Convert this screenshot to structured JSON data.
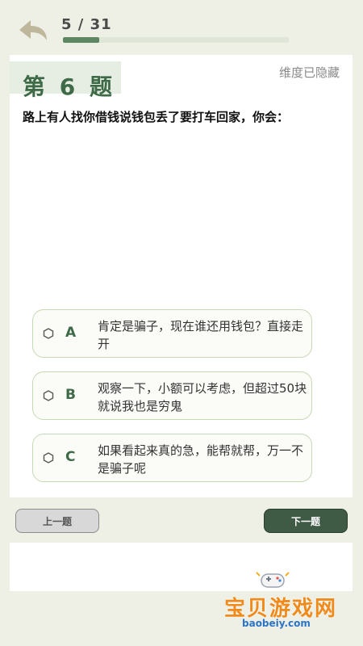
{
  "header": {
    "progress_text": "5 / 31",
    "progress_fraction": 0.161
  },
  "question": {
    "number_label": "第 6 题",
    "dimension_label": "维度已隐藏",
    "text": "路上有人找你借钱说钱包丢了要打车回家，你会："
  },
  "options": [
    {
      "letter": "A",
      "text": "肯定是骗子，现在谁还用钱包？直接走开"
    },
    {
      "letter": "B",
      "text": "观察一下，小额可以考虑，但超过50块就说我也是穷鬼"
    },
    {
      "letter": "C",
      "text": "如果看起来真的急，能帮就帮，万一不是骗子呢"
    }
  ],
  "nav": {
    "prev_label": "上一题",
    "next_label": "下一题"
  },
  "watermark": {
    "name": "宝贝游戏网",
    "url": "baobeiy.com"
  },
  "colors": {
    "accent": "#3e6a48",
    "progress_fill": "#5f8663",
    "option_border": "#c8d8b4",
    "next_button": "#3f5a45",
    "background": "#eef0e6"
  }
}
